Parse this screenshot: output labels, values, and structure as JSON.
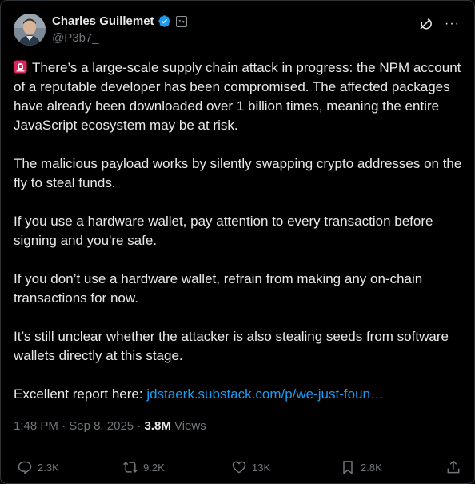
{
  "author": {
    "display_name": "Charles Guillemet",
    "handle": "@P3b7_",
    "verified_icon": "verified-badge-icon",
    "affiliation_icon": "affiliate-badge-icon"
  },
  "header_actions": {
    "grok_icon": "grok-icon",
    "more_label": "···"
  },
  "post": {
    "paragraphs": [
      "There’s a large-scale supply chain attack in progress: the NPM account of a reputable developer has been compromised. The affected packages have already been downloaded over 1 billion times, meaning the entire JavaScript ecosystem may be at risk.",
      "The malicious payload works by silently swapping crypto addresses on the fly to steal funds.",
      "If you use a hardware wallet, pay attention to every transaction before signing and you're safe.",
      "If you don’t use a hardware wallet, refrain from making any on-chain transactions for now.",
      "It’s still unclear whether the attacker is also stealing seeds from software wallets directly at this stage."
    ],
    "report_prefix": "Excellent report here: ",
    "report_link": "jdstaerk.substack.com/p/we-just-foun…",
    "leading_emoji": "siren-icon"
  },
  "meta": {
    "time": "1:48 PM",
    "separator": " · ",
    "date": "Sep 8, 2025",
    "views_count": "3.8M",
    "views_label": " Views"
  },
  "actions": {
    "replies": "2.3K",
    "reposts": "9.2K",
    "likes": "13K",
    "bookmarks": "2.8K"
  },
  "colors": {
    "background": "#000000",
    "text": "#e7e9ea",
    "muted": "#71767b",
    "link": "#1d9bf0",
    "verified": "#1d9bf0"
  }
}
